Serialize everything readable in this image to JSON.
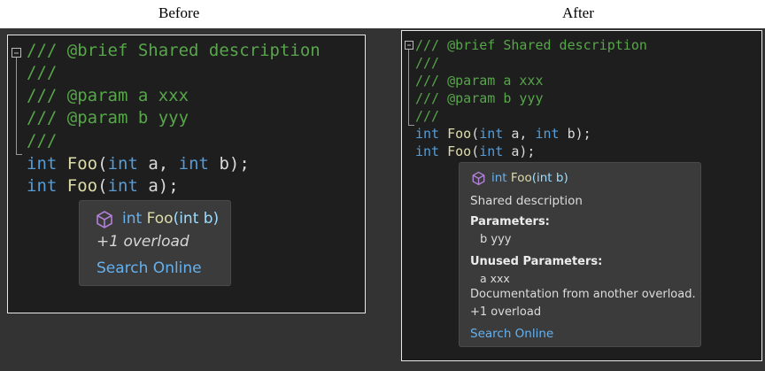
{
  "header": {
    "before": "Before",
    "after": "After"
  },
  "code": {
    "comment_brief": "/// @brief Shared description",
    "comment_empty": "///",
    "comment_param_a": "/// @param a xxx",
    "comment_param_b": "/// @param b yyy",
    "kw_int": "int",
    "fn_foo": "Foo",
    "open_paren": "(",
    "arg_a": " a",
    "comma": ", ",
    "arg_b": " b",
    "close": ");"
  },
  "tooltip_before": {
    "icon": "cube-icon",
    "sig_int": "int",
    "sig_fn": "Foo",
    "sig_args": "(int b)",
    "overload": "+1 overload",
    "search": "Search Online"
  },
  "tooltip_after": {
    "icon": "cube-icon",
    "sig_int": "int",
    "sig_fn": "Foo",
    "sig_args": "(int b)",
    "description": "Shared description",
    "params_title": "Parameters:",
    "param_b": "b yyy",
    "unused_title": "Unused Parameters:",
    "param_a": "a xxx",
    "doc_note": "Documentation from another overload.",
    "overload": "+1 overload",
    "search": "Search Online"
  },
  "colors": {
    "comment": "#57a64a",
    "keyword": "#569cd6",
    "function": "#dcdcaa",
    "link": "#65b1ef",
    "icon": "#b180d7"
  }
}
